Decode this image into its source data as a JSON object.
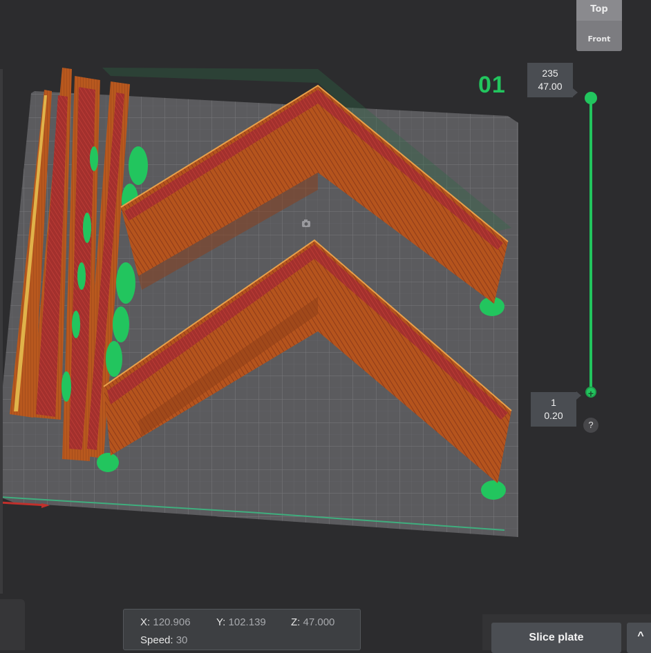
{
  "view_cube": {
    "top_label": "Top",
    "front_label": "Front"
  },
  "plate": {
    "number": "01"
  },
  "layer_slider": {
    "upper": {
      "layer": "235",
      "height": "47.00"
    },
    "lower": {
      "layer": "1",
      "height": "0.20"
    },
    "lower_handle_symbol": "+",
    "help_label": "?"
  },
  "position_readout": {
    "x_label": "X:",
    "x_value": "120.906",
    "y_label": "Y:",
    "y_value": "102.139",
    "z_label": "Z:",
    "z_value": "47.000",
    "speed_label": "Speed:",
    "speed_value": "30"
  },
  "actions": {
    "slice_plate": "Slice plate",
    "expand": "^"
  },
  "colors": {
    "accent": "#22c55e",
    "background": "#2c2c2e",
    "bed": "#5d5d60",
    "wall_outer": "#b8561c",
    "wall_inner": "#9c2f2a",
    "support": "#22c55e"
  },
  "icons": {
    "camera": "camera-icon"
  }
}
